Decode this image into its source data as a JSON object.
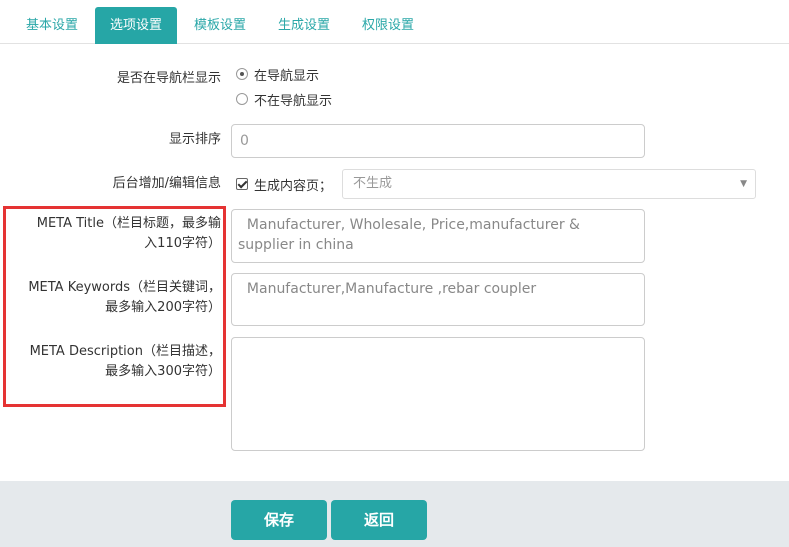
{
  "tabs": [
    {
      "label": "基本设置"
    },
    {
      "label": "选项设置"
    },
    {
      "label": "模板设置"
    },
    {
      "label": "生成设置"
    },
    {
      "label": "权限设置"
    }
  ],
  "nav_display": {
    "label": "是否在导航栏显示",
    "options": [
      {
        "label": "在导航显示",
        "checked": true
      },
      {
        "label": "不在导航显示",
        "checked": false
      }
    ]
  },
  "sort": {
    "label": "显示排序",
    "placeholder": "0"
  },
  "backend_info": {
    "label": "后台增加/编辑信息",
    "checkbox_label": "生成内容页；",
    "select_value": "不生成"
  },
  "meta_title": {
    "label_line1": "META Title（栏目标题，最多输",
    "label_line2": "入110字符）",
    "value": "  Manufacturer, Wholesale, Price,manufacturer & supplier in china"
  },
  "meta_keywords": {
    "label_line1": "META Keywords（栏目关键词，",
    "label_line2": "最多输入200字符）",
    "value": "  Manufacturer,Manufacture ,rebar coupler"
  },
  "meta_description": {
    "label_line1": "META Description（栏目描述，",
    "label_line2": "最多输入300字符）",
    "value": ""
  },
  "footer": {
    "save_label": "保存",
    "back_label": "返回"
  },
  "colors": {
    "accent": "#26a6a6",
    "highlight": "#e53333"
  }
}
